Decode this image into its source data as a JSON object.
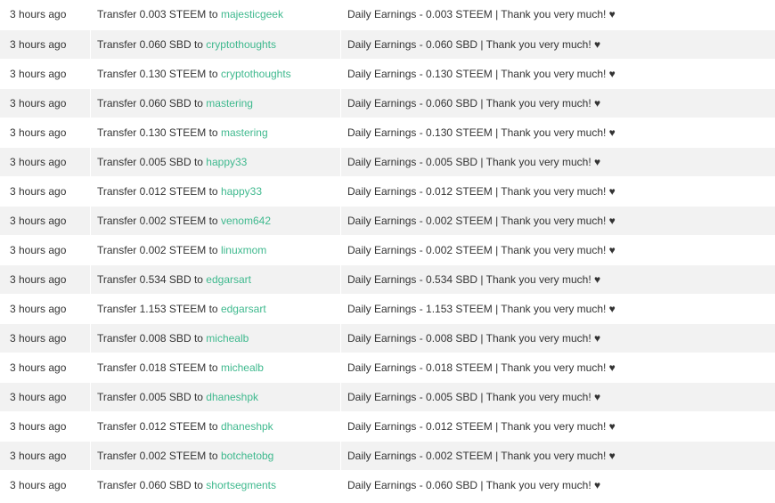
{
  "accent_color": "#3fb98e",
  "transfers": [
    {
      "time": "3 hours ago",
      "prefix": "Transfer 0.003 STEEM to",
      "recipient": "majesticgeek",
      "memo": "Daily Earnings - 0.003 STEEM | Thank you very much! ♥"
    },
    {
      "time": "3 hours ago",
      "prefix": "Transfer 0.060 SBD to",
      "recipient": "cryptothoughts",
      "memo": "Daily Earnings - 0.060 SBD | Thank you very much! ♥"
    },
    {
      "time": "3 hours ago",
      "prefix": "Transfer 0.130 STEEM to",
      "recipient": "cryptothoughts",
      "memo": "Daily Earnings - 0.130 STEEM | Thank you very much! ♥"
    },
    {
      "time": "3 hours ago",
      "prefix": "Transfer 0.060 SBD to",
      "recipient": "mastering",
      "memo": "Daily Earnings - 0.060 SBD | Thank you very much! ♥"
    },
    {
      "time": "3 hours ago",
      "prefix": "Transfer 0.130 STEEM to",
      "recipient": "mastering",
      "memo": "Daily Earnings - 0.130 STEEM | Thank you very much! ♥"
    },
    {
      "time": "3 hours ago",
      "prefix": "Transfer 0.005 SBD to",
      "recipient": "happy33",
      "memo": "Daily Earnings - 0.005 SBD | Thank you very much! ♥"
    },
    {
      "time": "3 hours ago",
      "prefix": "Transfer 0.012 STEEM to",
      "recipient": "happy33",
      "memo": "Daily Earnings - 0.012 STEEM | Thank you very much! ♥"
    },
    {
      "time": "3 hours ago",
      "prefix": "Transfer 0.002 STEEM to",
      "recipient": "venom642",
      "memo": "Daily Earnings - 0.002 STEEM | Thank you very much! ♥"
    },
    {
      "time": "3 hours ago",
      "prefix": "Transfer 0.002 STEEM to",
      "recipient": "linuxmom",
      "memo": "Daily Earnings - 0.002 STEEM | Thank you very much! ♥"
    },
    {
      "time": "3 hours ago",
      "prefix": "Transfer 0.534 SBD to",
      "recipient": "edgarsart",
      "memo": "Daily Earnings - 0.534 SBD | Thank you very much! ♥"
    },
    {
      "time": "3 hours ago",
      "prefix": "Transfer 1.153 STEEM to",
      "recipient": "edgarsart",
      "memo": "Daily Earnings - 1.153 STEEM | Thank you very much! ♥"
    },
    {
      "time": "3 hours ago",
      "prefix": "Transfer 0.008 SBD to",
      "recipient": "michealb",
      "memo": "Daily Earnings - 0.008 SBD | Thank you very much! ♥"
    },
    {
      "time": "3 hours ago",
      "prefix": "Transfer 0.018 STEEM to",
      "recipient": "michealb",
      "memo": "Daily Earnings - 0.018 STEEM | Thank you very much! ♥"
    },
    {
      "time": "3 hours ago",
      "prefix": "Transfer 0.005 SBD to",
      "recipient": "dhaneshpk",
      "memo": "Daily Earnings - 0.005 SBD | Thank you very much! ♥"
    },
    {
      "time": "3 hours ago",
      "prefix": "Transfer 0.012 STEEM to",
      "recipient": "dhaneshpk",
      "memo": "Daily Earnings - 0.012 STEEM | Thank you very much! ♥"
    },
    {
      "time": "3 hours ago",
      "prefix": "Transfer 0.002 STEEM to",
      "recipient": "botchetobg",
      "memo": "Daily Earnings - 0.002 STEEM | Thank you very much! ♥"
    },
    {
      "time": "3 hours ago",
      "prefix": "Transfer 0.060 SBD to",
      "recipient": "shortsegments",
      "memo": "Daily Earnings - 0.060 SBD | Thank you very much! ♥"
    }
  ]
}
